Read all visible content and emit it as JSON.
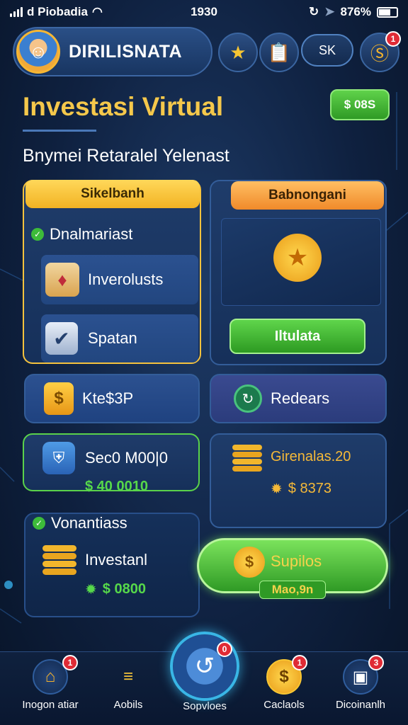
{
  "status_bar": {
    "carrier": "d Piobadia",
    "time": "1930",
    "battery": "876%"
  },
  "header": {
    "brand": "DIRILISNATA",
    "pill_label": "SK",
    "coin_badge": "1"
  },
  "page": {
    "title": "Investasi Virtual",
    "cash_label": "$ 08S",
    "subtitle": "Bnymei Retaralel Yelenast"
  },
  "left_panel": {
    "tab": "Sikelbanh",
    "section_title": "Dnalmariast",
    "items": [
      {
        "label": "Inverolusts",
        "icon": "gem-basket-icon"
      },
      {
        "label": "Spatan",
        "icon": "checklist-icon"
      }
    ]
  },
  "right_panel": {
    "tab": "Babnongani",
    "button_label": "Iltulata",
    "icon": "star-pin-icon"
  },
  "row_cards": [
    {
      "label": "Kte$3P",
      "icon": "dollar-shield-icon"
    },
    {
      "label": "Redears",
      "icon": "refresh-pin-icon"
    }
  ],
  "stat_cards": [
    {
      "title": "Sec0 M00|0",
      "amount": "$ 40 0010",
      "icon": "shield-icon"
    },
    {
      "title": "Girenalas.20",
      "amount": "$ 8373",
      "icon": "coin-stack-icon"
    }
  ],
  "bottom_left": {
    "section_title": "Vonantiass",
    "item_label": "Investanl",
    "amount": "$ 0800"
  },
  "big_button": {
    "label": "Supilos",
    "sub_label": "Mao,9n"
  },
  "nav": {
    "items": [
      {
        "label": "Inogon atiar",
        "badge": "1",
        "icon": "home-icon"
      },
      {
        "label": "Aobils",
        "badge": "",
        "icon": "stack-icon"
      },
      {
        "label": "Sopvloes",
        "badge": "0",
        "icon": "swirl-icon"
      },
      {
        "label": "Caclaols",
        "badge": "1",
        "icon": "dollar-coin-icon"
      },
      {
        "label": "Dicoinanlh",
        "badge": "3",
        "icon": "camera-icon"
      }
    ]
  },
  "colors": {
    "gold": "#f5c84b",
    "green": "#3dbb3a",
    "panel": "#1f3c6a",
    "badge_red": "#e02b35"
  }
}
